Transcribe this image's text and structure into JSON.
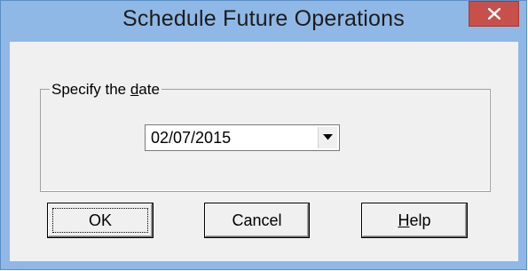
{
  "window": {
    "title": "Schedule Future Operations"
  },
  "group": {
    "legend_pre": "Specify the ",
    "legend_access": "d",
    "legend_post": "ate"
  },
  "date_field": {
    "value": "02/07/2015"
  },
  "buttons": {
    "ok": "OK",
    "cancel": "Cancel",
    "help_access": "H",
    "help_rest": "elp"
  },
  "icons": {
    "close": "close-icon",
    "dropdown": "chevron-down-icon"
  },
  "colors": {
    "frame": "#8fb8e6",
    "close": "#c7504b",
    "client": "#f0f0f0"
  }
}
